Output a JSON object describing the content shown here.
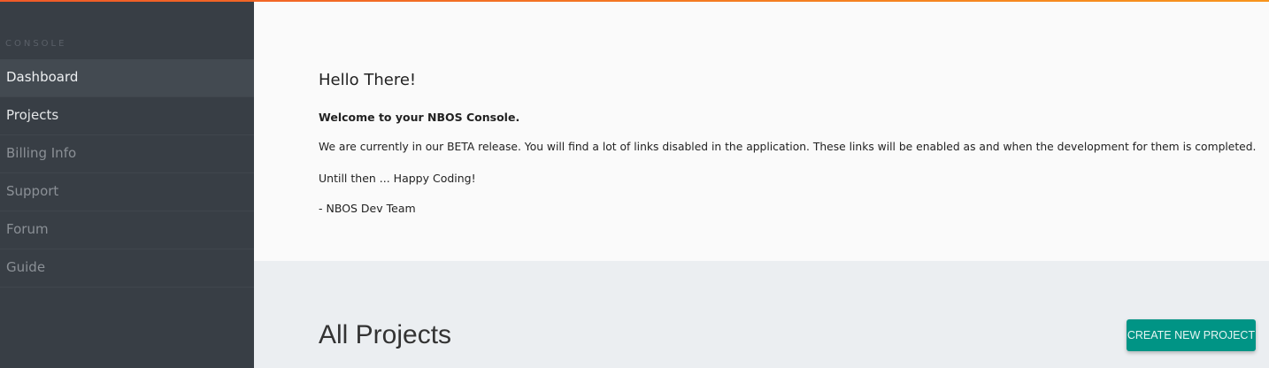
{
  "sidebar": {
    "section_label": "CONSOLE",
    "items": [
      {
        "label": "Dashboard"
      },
      {
        "label": "Projects"
      },
      {
        "label": "Billing Info"
      },
      {
        "label": "Support"
      },
      {
        "label": "Forum"
      },
      {
        "label": "Guide"
      }
    ]
  },
  "welcome": {
    "title": "Hello There!",
    "bold": "Welcome to your NBOS Console.",
    "line1": "We are currently in our BETA release. You will find a lot of links disabled in the application. These links will be enabled as and when the development for them is completed.",
    "line2": "Untill then ... Happy Coding!",
    "signature": "- NBOS Dev Team"
  },
  "projects": {
    "title": "All Projects",
    "create_label": "CREATE NEW PROJECT"
  },
  "colors": {
    "accent": "#009485",
    "sidebar": "#383e45",
    "topbar": "#f05a28"
  }
}
